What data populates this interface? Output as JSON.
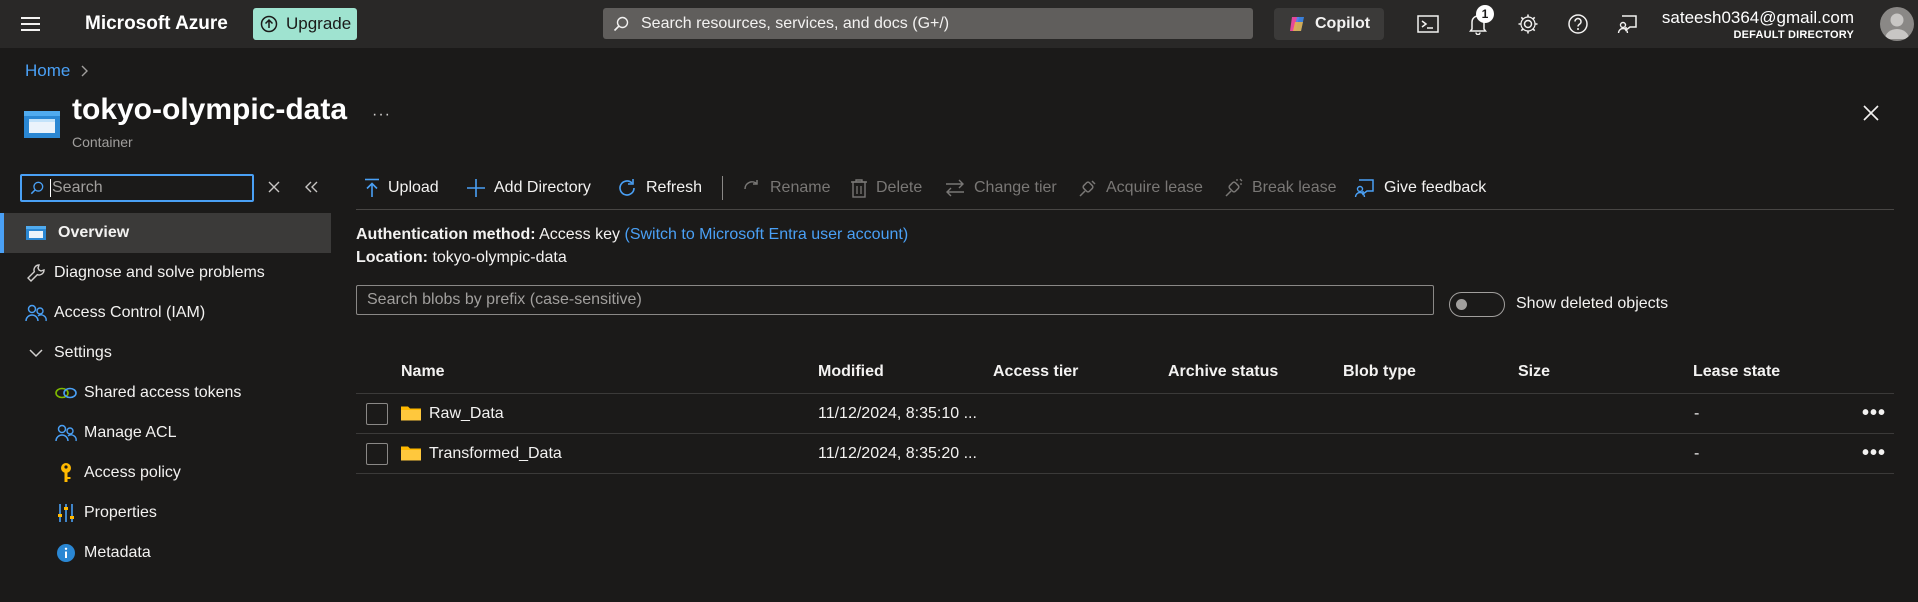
{
  "topbar": {
    "brand": "Microsoft Azure",
    "upgrade_label": "Upgrade",
    "search_placeholder": "Search resources, services, and docs (G+/)",
    "copilot_label": "Copilot",
    "notification_count": "1",
    "user_email": "sateesh0364@gmail.com",
    "user_directory": "DEFAULT DIRECTORY"
  },
  "breadcrumb": {
    "home": "Home"
  },
  "header": {
    "title": "tokyo-olympic-data",
    "subtitle": "Container",
    "more": "···"
  },
  "sidebar": {
    "search_placeholder": "Search",
    "items": [
      {
        "label": "Overview",
        "icon": "container-icon",
        "active": true
      },
      {
        "label": "Diagnose and solve problems",
        "icon": "wrench-icon"
      },
      {
        "label": "Access Control (IAM)",
        "icon": "people-icon"
      },
      {
        "label": "Settings",
        "icon": "chevron-down-icon"
      },
      {
        "label": "Shared access tokens",
        "icon": "link-icon"
      },
      {
        "label": "Manage ACL",
        "icon": "people-icon"
      },
      {
        "label": "Access policy",
        "icon": "key-icon"
      },
      {
        "label": "Properties",
        "icon": "sliders-icon"
      },
      {
        "label": "Metadata",
        "icon": "info-icon"
      }
    ]
  },
  "toolbar": {
    "upload": "Upload",
    "add_directory": "Add Directory",
    "refresh": "Refresh",
    "rename": "Rename",
    "delete": "Delete",
    "change_tier": "Change tier",
    "acquire_lease": "Acquire lease",
    "break_lease": "Break lease",
    "give_feedback": "Give feedback"
  },
  "info": {
    "auth_label": "Authentication method:",
    "auth_value": "Access key",
    "auth_link": "(Switch to Microsoft Entra user account)",
    "location_label": "Location:",
    "location_value": "tokyo-olympic-data"
  },
  "blob_search_placeholder": "Search blobs by prefix (case-sensitive)",
  "show_deleted_label": "Show deleted objects",
  "table": {
    "columns": [
      "Name",
      "Modified",
      "Access tier",
      "Archive status",
      "Blob type",
      "Size",
      "Lease state"
    ],
    "rows": [
      {
        "name": "Raw_Data",
        "modified": "11/12/2024, 8:35:10 ...",
        "lease_state": "-",
        "more": "•••"
      },
      {
        "name": "Transformed_Data",
        "modified": "11/12/2024, 8:35:20 ...",
        "lease_state": "-",
        "more": "•••"
      }
    ]
  },
  "colors": {
    "accent": "#4aa0f5",
    "upgrade_bg": "#9fe3d0",
    "folder": "#ffb900",
    "background": "#1b1a19"
  }
}
